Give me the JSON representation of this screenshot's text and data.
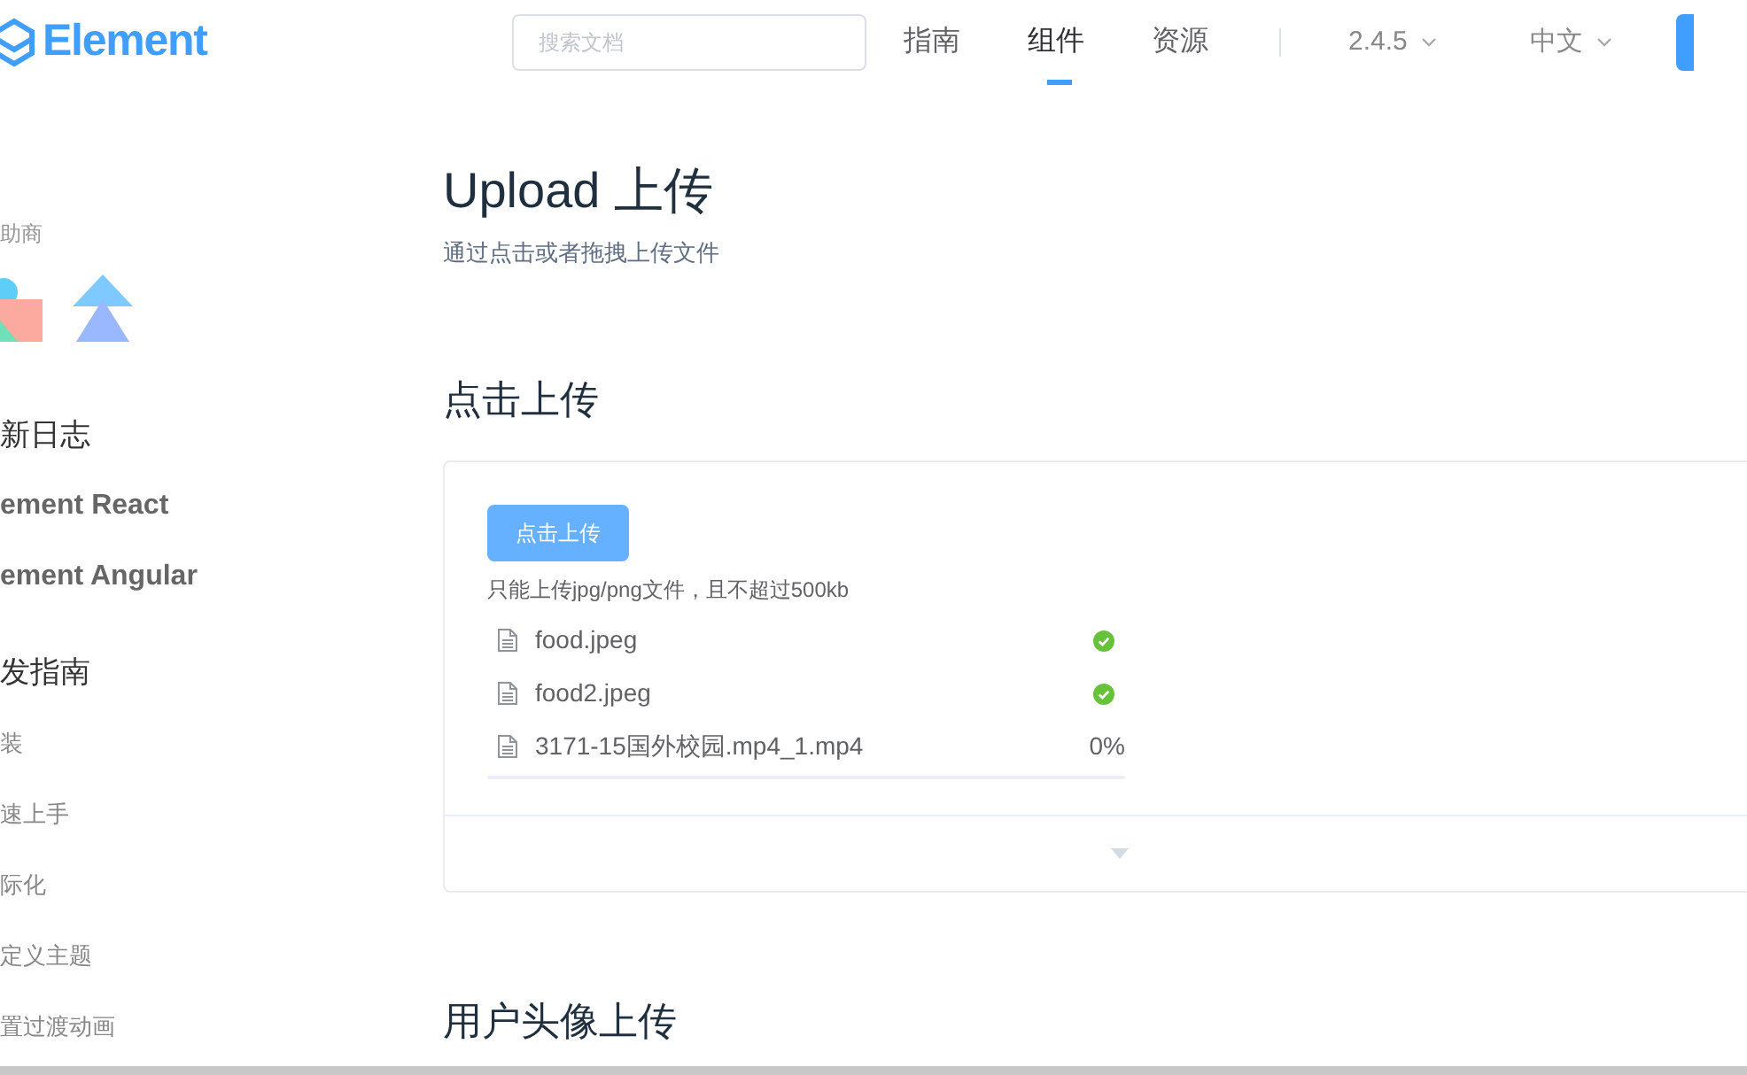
{
  "header": {
    "logo": "Element",
    "search": {
      "placeholder": "搜索文档"
    },
    "nav": [
      {
        "label": "指南",
        "selected": false
      },
      {
        "label": "组件",
        "selected": true
      },
      {
        "label": "资源",
        "selected": false
      }
    ],
    "version": "2.4.5",
    "language": "中文"
  },
  "sidebar": {
    "sponsor_label": "助商",
    "links": [
      {
        "label": "新日志",
        "kind": "heading"
      },
      {
        "label": "ement React",
        "kind": "link"
      },
      {
        "label": "ement Angular",
        "kind": "link"
      },
      {
        "label": "发指南",
        "kind": "heading"
      },
      {
        "label": "装",
        "kind": "item"
      },
      {
        "label": "速上手",
        "kind": "item"
      },
      {
        "label": "际化",
        "kind": "item"
      },
      {
        "label": "定义主题",
        "kind": "item"
      },
      {
        "label": "置过渡动画",
        "kind": "item"
      }
    ]
  },
  "page": {
    "title": "Upload 上传",
    "subtitle": "通过点击或者拖拽上传文件",
    "section": "点击上传",
    "demo": {
      "button": "点击上传",
      "tip": "只能上传jpg/png文件，且不超过500kb",
      "files": [
        {
          "name": "food.jpeg",
          "kind": "success"
        },
        {
          "name": "food2.jpeg",
          "kind": "success"
        },
        {
          "name": "3171-15国外校园.mp4_1.mp4",
          "kind": "uploading",
          "reading": "0%",
          "level": 0
        }
      ]
    },
    "next_section": "用户头像上传"
  }
}
